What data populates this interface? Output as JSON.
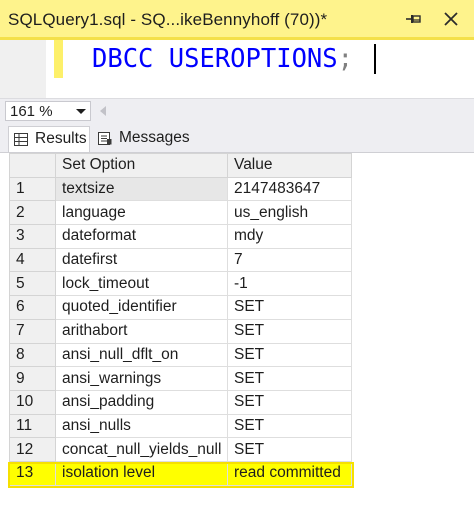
{
  "tab": {
    "title": "SQLQuery1.sql - SQ...ikeBennyhoff (70))*",
    "pin_icon": "pin-icon",
    "close_icon": "close-icon",
    "accent_color": "#fef38c"
  },
  "editor": {
    "code": "DBCC USEROPTIONS",
    "terminator": ";",
    "keyword_color": "#0000ff"
  },
  "zoom": {
    "value": "161 %"
  },
  "results_tabs": [
    {
      "label": "Results",
      "icon": "grid-icon",
      "active": true
    },
    {
      "label": "Messages",
      "icon": "messages-icon",
      "active": false
    }
  ],
  "grid": {
    "columns": [
      "Set Option",
      "Value"
    ],
    "rows": [
      {
        "num": "1",
        "option": "textsize",
        "value": "2147483647"
      },
      {
        "num": "2",
        "option": "language",
        "value": "us_english"
      },
      {
        "num": "3",
        "option": "dateformat",
        "value": "mdy"
      },
      {
        "num": "4",
        "option": "datefirst",
        "value": "7"
      },
      {
        "num": "5",
        "option": "lock_timeout",
        "value": "-1"
      },
      {
        "num": "6",
        "option": "quoted_identifier",
        "value": "SET"
      },
      {
        "num": "7",
        "option": "arithabort",
        "value": "SET"
      },
      {
        "num": "8",
        "option": "ansi_null_dflt_on",
        "value": "SET"
      },
      {
        "num": "9",
        "option": "ansi_warnings",
        "value": "SET"
      },
      {
        "num": "10",
        "option": "ansi_padding",
        "value": "SET"
      },
      {
        "num": "11",
        "option": "ansi_nulls",
        "value": "SET"
      },
      {
        "num": "12",
        "option": "concat_null_yields_null",
        "value": "SET"
      },
      {
        "num": "13",
        "option": "isolation level",
        "value": "read committed"
      }
    ],
    "highlight_color": "#ffff00"
  }
}
